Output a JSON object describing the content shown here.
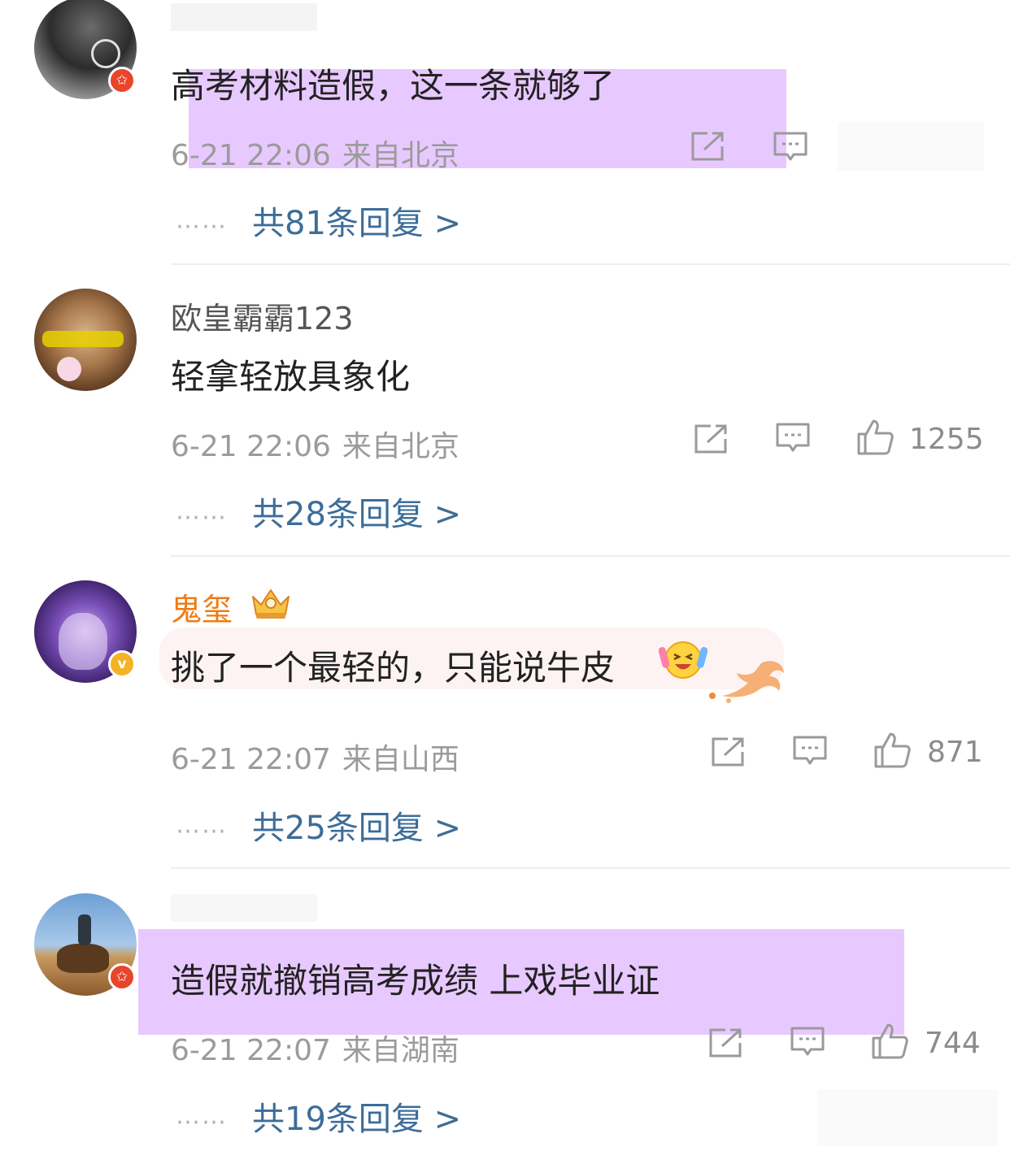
{
  "comments": [
    {
      "username": "",
      "text": "高考材料造假，这一条就够了",
      "time": "6-21 22:06",
      "location": "来自北京",
      "likes": "",
      "replies_link": "共81条回复 >",
      "badge_icon": "red-star-badge-icon"
    },
    {
      "username": "欧皇霸霸123",
      "text": "轻拿轻放具象化",
      "time": "6-21 22:06",
      "location": "来自北京",
      "likes": "1255",
      "replies_link": "共28条回复 >"
    },
    {
      "username": "鬼玺",
      "text": "挑了一个最轻的，只能说牛皮",
      "time": "6-21 22:07",
      "location": "来自山西",
      "likes": "871",
      "replies_link": "共25条回复 >",
      "badge_icon": "gold-v-badge-icon",
      "username_color": "#f07a13"
    },
    {
      "username": "",
      "text": "造假就撤销高考成绩 上戏毕业证",
      "time": "6-21 22:07",
      "location": "来自湖南",
      "likes": "744",
      "replies_link": "共19条回复 >",
      "badge_icon": "red-star-badge-icon"
    }
  ],
  "dots": "……",
  "badge_glyphs": {
    "star": "✩",
    "v": "v"
  },
  "highlight_color": "#e6c4ff"
}
